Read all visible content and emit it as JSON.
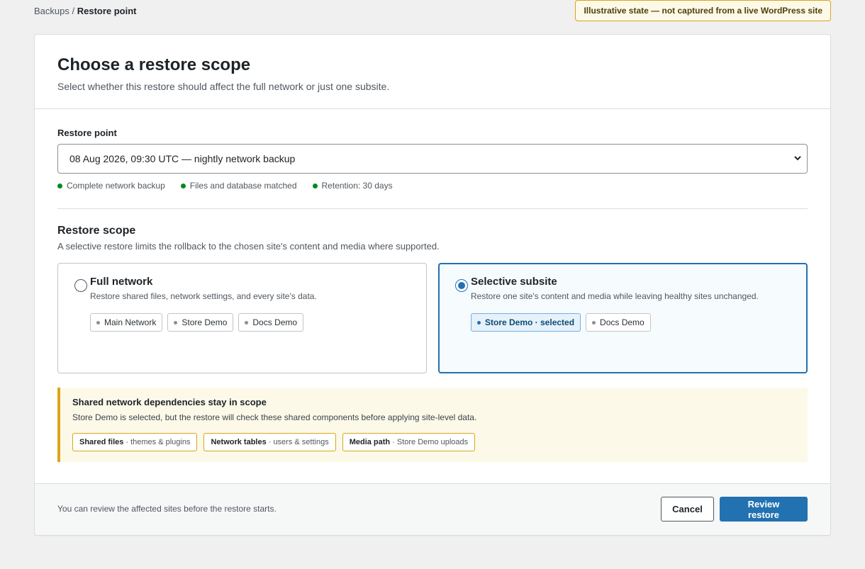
{
  "breadcrumb": {
    "parent": "Backups",
    "separator": " / ",
    "current": "Restore point"
  },
  "notice": "Illustrative state — not captured from a live WordPress site",
  "header": {
    "title": "Choose a restore scope",
    "subtitle": "Select whether this restore should affect the full network or just one subsite."
  },
  "restore_point": {
    "label": "Restore point",
    "selected": "08 Aug 2026, 09:30 UTC — nightly network backup",
    "checks": [
      "Complete network backup",
      "Files and database matched",
      "Retention: 30 days"
    ]
  },
  "scope": {
    "title": "Restore scope",
    "description": "A selective restore limits the rollback to the chosen site's content and media where supported.",
    "options": [
      {
        "title": "Full network",
        "description": "Restore shared files, network settings, and every site's data.",
        "selected": false,
        "chips": [
          "Main Network",
          "Store Demo",
          "Docs Demo"
        ]
      },
      {
        "title": "Selective subsite",
        "description": "Restore one site's content and media while leaving healthy sites unchanged.",
        "selected": true,
        "chips": [
          "Store Demo · selected",
          "Docs Demo"
        ]
      }
    ]
  },
  "dependencies": {
    "title": "Shared network dependencies stay in scope",
    "description": "Store Demo is selected, but the restore will check these shared components before applying site-level data.",
    "items": [
      {
        "name": "Shared files",
        "detail": "· themes & plugins"
      },
      {
        "name": "Network tables",
        "detail": "· users & settings"
      },
      {
        "name": "Media path",
        "detail": "· Store Demo uploads"
      }
    ]
  },
  "footer": {
    "note": "You can review the affected sites before the restore starts.",
    "cancel_label": "Cancel",
    "primary_label": "Review restore"
  },
  "colors": {
    "accent": "#2271b1",
    "success": "#008a20",
    "warning": "#dba617",
    "warning_bg": "#fcf9e8"
  }
}
